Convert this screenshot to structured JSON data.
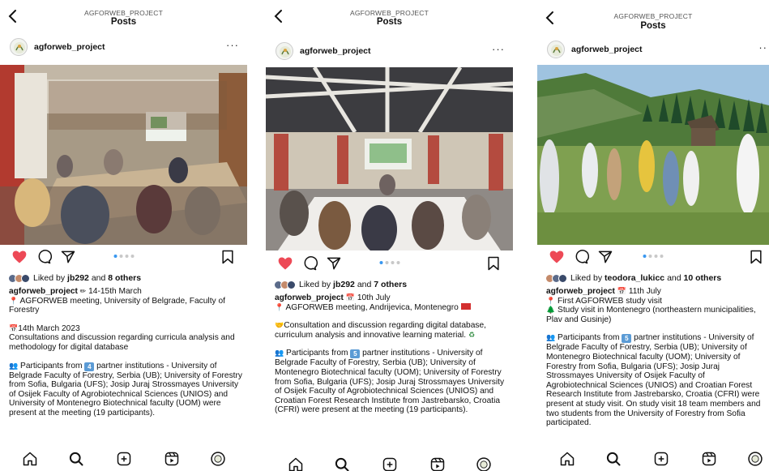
{
  "posts": [
    {
      "header_user": "AGFORWEB_PROJECT",
      "header_title": "Posts",
      "account": "agforweb_project",
      "likes_prefix": "Liked by ",
      "likes_user": "jb292",
      "likes_mid": " and ",
      "likes_count": "8 others",
      "caption": {
        "line1_user": "agforweb_project",
        "line1_rest": " 14-15th March",
        "line2": " AGFORWEB meeting, University of Belgrade, Faculty of Forestry",
        "date_line": "14th March 2023",
        "body": "Consultations and discussion regarding curricula analysis and methodology for digital database",
        "participants_pre": " Participants from ",
        "participants_num": "4",
        "participants_post": " partner institutions - University of Belgrade Faculty of Forestry, Serbia (UB); University of Forestry from Sofia, Bulgaria (UFS); Josip Juraj Strossmayes University of Osijek Faculty of Agrobiotechnical Sciences (UNIOS) and University of Montenegro Biotechnical faculty (UOM) were present at the meeting (19 participants)."
      }
    },
    {
      "header_user": "AGFORWEB_PROJECT",
      "header_title": "Posts",
      "account": "agforweb_project",
      "likes_prefix": "Liked by ",
      "likes_user": "jb292",
      "likes_mid": " and ",
      "likes_count": "7 others",
      "caption": {
        "line1_user": "agforweb_project",
        "line1_rest": " 10th July",
        "line2": " AGFORWEB meeting, Andrijevica, Montenegro",
        "body": "Consultation and discussion regarding digital database, curriculum analysis and innovative learning material.",
        "participants_pre": " Participants from ",
        "participants_num": "5",
        "participants_post": " partner institutions - University of Belgrade Faculty of Forestry, Serbia (UB); University of Montenegro Biotechnical faculty (UOM); University of Forestry from Sofia, Bulgaria (UFS); Josip Juraj Strossmayes University of Osijek Faculty of Agrobiotechnical Sciences (UNIOS) and Croatian Forest Research Institute from Jastrebarsko, Croatia (CFRI) were present at the meeting (19 participants)."
      }
    },
    {
      "header_user": "AGFORWEB_PROJECT",
      "header_title": "Posts",
      "account": "agforweb_project",
      "likes_prefix": "Liked by ",
      "likes_user": "teodora_lukicc",
      "likes_mid": " and ",
      "likes_count": "10 others",
      "caption": {
        "line1_user": "agforweb_project",
        "line1_rest": " 11th July",
        "line2": " First AGFORWEB study visit",
        "line3": " Study visit in Montenegro (northeastern municipalities, Plav and Gusinje)",
        "participants_pre": " Participants from ",
        "participants_num": "5",
        "participants_post": " partner institutions - University of Belgrade Faculty of Forestry, Serbia (UB); University of Montenegro Biotechnical faculty (UOM); University of Forestry from Sofia, Bulgaria (UFS); Josip Juraj Strossmayes University of Osijek Faculty of Agrobiotechnical Sciences (UNIOS) and Croatian Forest Research Institute from Jastrebarsko, Croatia (CFRI) were present at study visit. On study visit 18 team members and two students from the University of Forestry from Sofia participated."
      }
    }
  ],
  "colors": {
    "heart": "#ed4956",
    "dot_active": "#3897f0",
    "dot_inactive": "#c8c8c8",
    "badge": "#5b9bd5"
  },
  "icons": [
    "back-icon",
    "more-icon",
    "heart-icon",
    "comment-icon",
    "share-icon",
    "bookmark-icon",
    "home-icon",
    "search-icon",
    "create-icon",
    "reels-icon",
    "profile-icon"
  ]
}
